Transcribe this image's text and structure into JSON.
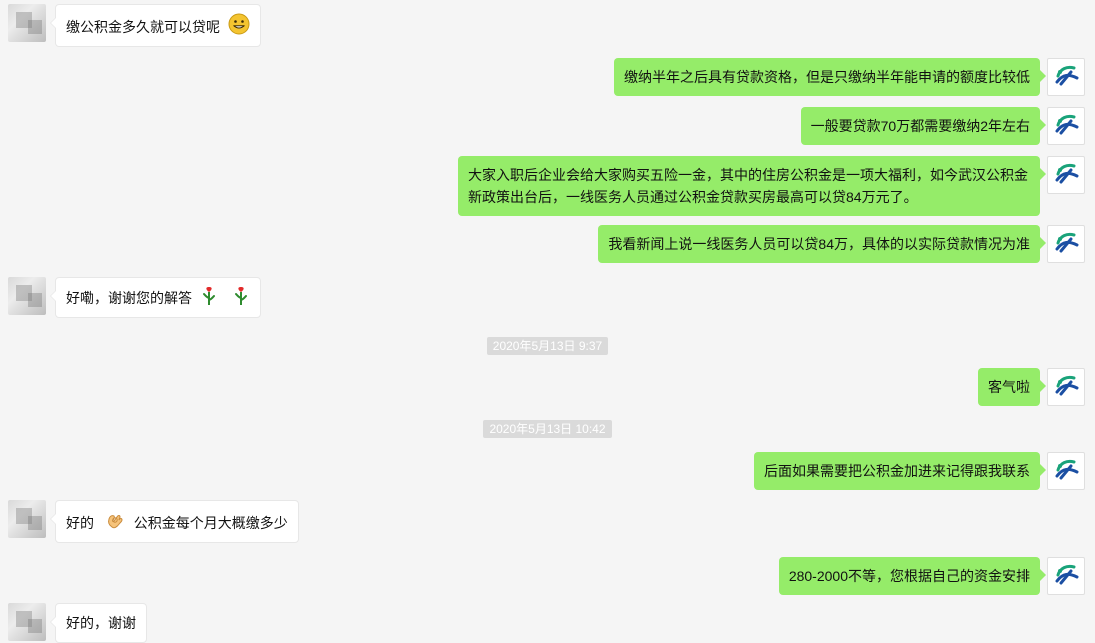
{
  "messages": [
    {
      "side": "left",
      "text": "缴公积金多久就可以贷呢",
      "emoji": "grin-icon"
    },
    {
      "side": "right",
      "text": "缴纳半年之后具有贷款资格，但是只缴纳半年能申请的额度比较低"
    },
    {
      "side": "right",
      "text": "一般要贷款70万都需要缴纳2年左右"
    },
    {
      "side": "right",
      "text": "大家入职后企业会给大家购买五险一金，其中的住房公积金是一项大福利，如今武汉公积金新政策出台后，一线医务人员通过公积金贷款买房最高可以贷84万元了。"
    },
    {
      "side": "right",
      "text": "我看新闻上说一线医务人员可以贷84万，具体的以实际贷款情况为准"
    },
    {
      "side": "left",
      "text": "好嘞，谢谢您的解答",
      "emoji": "rose-icon",
      "emoji_count": 2
    },
    {
      "side": "timestamp",
      "text": "2020年5月13日 9:37"
    },
    {
      "side": "right",
      "text": "客气啦"
    },
    {
      "side": "timestamp",
      "text": "2020年5月13日 10:42"
    },
    {
      "side": "right",
      "text": "后面如果需要把公积金加进来记得跟我联系"
    },
    {
      "side": "left",
      "text_before": "好的",
      "emoji": "ok-hand-icon",
      "text_after": "公积金每个月大概缴多少"
    },
    {
      "side": "right",
      "text": "280-2000不等，您根据自己的资金安排"
    },
    {
      "side": "left",
      "text": "好的，谢谢"
    }
  ],
  "colors": {
    "background": "#f5f5f5",
    "bubble_left": "#ffffff",
    "bubble_right": "#95ec69",
    "timestamp_bg": "#dadada",
    "timestamp_text": "#ffffff"
  },
  "icons": {
    "left_avatar": "pixelated-avatar",
    "right_avatar": "bird-logo-avatar"
  }
}
